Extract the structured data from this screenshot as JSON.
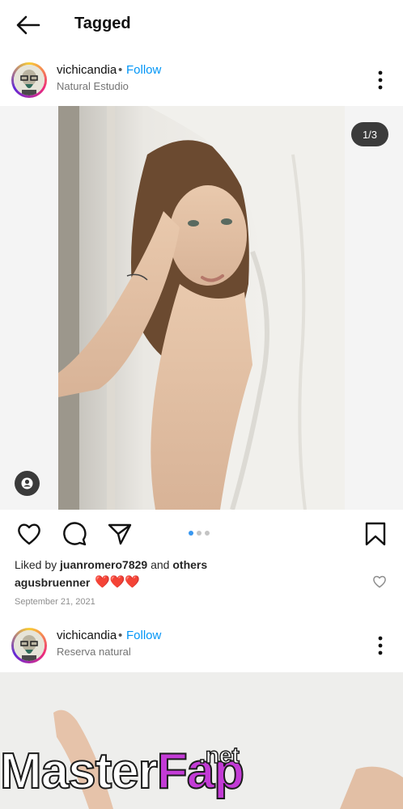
{
  "header": {
    "title": "Tagged"
  },
  "posts": [
    {
      "username": "vichicandia",
      "separator": "•",
      "follow_label": "Follow",
      "location": "Natural Estudio",
      "counter": "1/3",
      "liked_by_prefix": "Liked by ",
      "liked_by_user": "juanromero7829",
      "liked_by_and": " and ",
      "liked_by_others": "others",
      "caption_user": "agusbruenner",
      "caption_emojis": "❤️❤️❤️",
      "date": "September 21, 2021",
      "carousel_index": 1,
      "carousel_count": 3
    },
    {
      "username": "vichicandia",
      "separator": "•",
      "follow_label": "Follow",
      "location": "Reserva natural"
    }
  ],
  "watermark": {
    "part1": "Master",
    "part2": "Fap",
    "suffix": ".net"
  },
  "colors": {
    "accent": "#0095f6",
    "heart": "#e0245e",
    "active_dot": "#3897f0"
  }
}
